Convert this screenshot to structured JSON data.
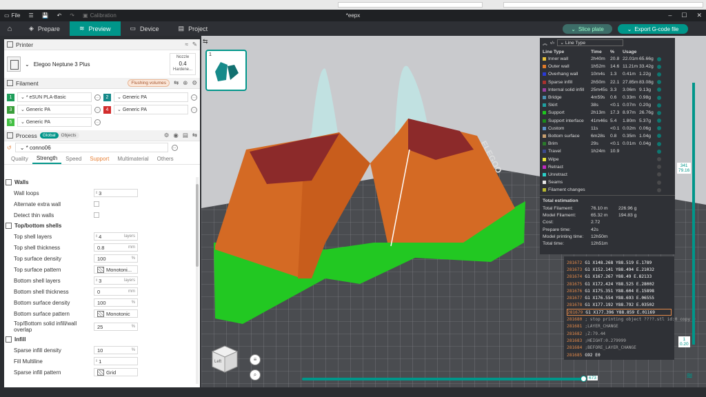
{
  "titlebar": {
    "file_label": "File",
    "calibration_label": "Calibration",
    "doc_title": "*eepx",
    "minimize": "–",
    "maximize": "☐",
    "close": "✕"
  },
  "tabs": [
    {
      "label": "Prepare"
    },
    {
      "label": "Preview"
    },
    {
      "label": "Device"
    },
    {
      "label": "Project"
    }
  ],
  "actions": {
    "slice_label": "Slice plate",
    "export_label": "Export G-code file"
  },
  "printer": {
    "section_label": "Printer",
    "name": "Elegoo Neptune 3 Plus",
    "nozzle_label": "Nozzle",
    "nozzle_value": "0.4",
    "nozzle_sub": "Hardene..."
  },
  "filament": {
    "section_label": "Filament",
    "flush_label": "Flushing volumes",
    "items": [
      {
        "num": "1",
        "name": "* eSUN PLA-Basic",
        "color": "#1f9e5a"
      },
      {
        "num": "2",
        "name": "Generic PA",
        "color": "#168a8a"
      },
      {
        "num": "3",
        "name": "Generic PA",
        "color": "#3a9e3a"
      },
      {
        "num": "4",
        "name": "Generic PA",
        "color": "#d22c2c"
      },
      {
        "num": "5",
        "name": "Generic PA",
        "color": "#44c044"
      }
    ]
  },
  "process": {
    "section_label": "Process",
    "global_label": "Global",
    "objects_label": "Objects",
    "preset_name": "* conno06",
    "tabs": [
      "Quality",
      "Strength",
      "Speed",
      "Support",
      "Multimaterial",
      "Others"
    ]
  },
  "settings": {
    "walls_label": "Walls",
    "wall_loops_label": "Wall loops",
    "wall_loops_value": "3",
    "alt_extra_wall_label": "Alternate extra wall",
    "detect_thin_walls_label": "Detect thin walls",
    "top_bottom_label": "Top/bottom shells",
    "top_layers_label": "Top shell layers",
    "top_layers_value": "4",
    "top_layers_unit": "layers",
    "top_thickness_label": "Top shell thickness",
    "top_thickness_value": "0.8",
    "top_thickness_unit": "mm",
    "top_density_label": "Top surface density",
    "top_density_value": "100",
    "top_density_unit": "%",
    "top_pattern_label": "Top surface pattern",
    "top_pattern_value": "Monotoni...",
    "bottom_layers_label": "Bottom shell layers",
    "bottom_layers_value": "3",
    "bottom_layers_unit": "layers",
    "bottom_thickness_label": "Bottom shell thickness",
    "bottom_thickness_value": "0",
    "bottom_thickness_unit": "mm",
    "bottom_density_label": "Bottom surface density",
    "bottom_density_value": "100",
    "bottom_density_unit": "%",
    "bottom_pattern_label": "Bottom surface pattern",
    "bottom_pattern_value": "Monotonic",
    "solid_overlap_label_1": "Top/Bottom solid infill/wall",
    "solid_overlap_label_2": "overlap",
    "solid_overlap_value": "25",
    "solid_overlap_unit": "%",
    "infill_label": "Infill",
    "sparse_density_label": "Sparse infill density",
    "sparse_density_value": "10",
    "sparse_density_unit": "%",
    "fill_multiline_label": "Fill Multiline",
    "fill_multiline_value": "1",
    "sparse_pattern_label": "Sparse infill pattern",
    "sparse_pattern_value": "Grid"
  },
  "plate": {
    "number": "1"
  },
  "legend": {
    "view_type": "Line Type",
    "headers": [
      "Line Type",
      "Time",
      "%",
      "Usage"
    ],
    "rows": [
      {
        "name": "Inner wall",
        "time": "2h40m",
        "pct": "20.8",
        "len": "22.01m",
        "weight": "65.66g",
        "color": "#e8c13a"
      },
      {
        "name": "Outer wall",
        "time": "1h52m",
        "pct": "14.6",
        "len": "11.21m",
        "weight": "33.42g",
        "color": "#e07b2a"
      },
      {
        "name": "Overhang wall",
        "time": "10m4s",
        "pct": "1.3",
        "len": "0.41m",
        "weight": "1.22g",
        "color": "#2a3ad6"
      },
      {
        "name": "Sparse infill",
        "time": "2h50m",
        "pct": "22.1",
        "len": "27.85m",
        "weight": "83.08g",
        "color": "#a8322e"
      },
      {
        "name": "Internal solid infill",
        "time": "25m45s",
        "pct": "3.3",
        "len": "3.06m",
        "weight": "9.13g",
        "color": "#9a3fa0"
      },
      {
        "name": "Bridge",
        "time": "4m59s",
        "pct": "0.6",
        "len": "0.33m",
        "weight": "0.98g",
        "color": "#4a8fb0"
      },
      {
        "name": "Skirt",
        "time": "38s",
        "pct": "<0.1",
        "len": "0.07m",
        "weight": "0.20g",
        "color": "#1fa0a0"
      },
      {
        "name": "Support",
        "time": "2h13m",
        "pct": "17.3",
        "len": "8.97m",
        "weight": "26.76g",
        "color": "#1ec81e"
      },
      {
        "name": "Support interface",
        "time": "41m46s",
        "pct": "5.4",
        "len": "1.80m",
        "weight": "5.37g",
        "color": "#1a8a1a"
      },
      {
        "name": "Custom",
        "time": "11s",
        "pct": "<0.1",
        "len": "0.02m",
        "weight": "0.06g",
        "color": "#5e92c8"
      },
      {
        "name": "Bottom surface",
        "time": "6m28s",
        "pct": "0.8",
        "len": "0.35m",
        "weight": "1.04g",
        "color": "#c8a070"
      },
      {
        "name": "Brim",
        "time": "29s",
        "pct": "<0.1",
        "len": "0.01m",
        "weight": "0.04g",
        "color": "#2a7a2a"
      },
      {
        "name": "Travel",
        "time": "1h24m",
        "pct": "10.9",
        "len": "",
        "weight": "",
        "color": "#3c4a8c"
      },
      {
        "name": "Wipe",
        "time": "",
        "pct": "",
        "len": "",
        "weight": "",
        "color": "#e8e43a"
      },
      {
        "name": "Retract",
        "time": "",
        "pct": "",
        "len": "",
        "weight": "",
        "color": "#c02ac0"
      },
      {
        "name": "Unretract",
        "time": "",
        "pct": "",
        "len": "",
        "weight": "",
        "color": "#2ad0c8"
      },
      {
        "name": "Seams",
        "time": "",
        "pct": "",
        "len": "",
        "weight": "",
        "color": "#e8e8e8"
      },
      {
        "name": "Filament changes",
        "time": "",
        "pct": "",
        "len": "",
        "weight": "",
        "color": "#b8b830"
      }
    ],
    "total_label": "Total estimation",
    "totals": [
      {
        "label": "Total Filament:",
        "a": "76.10 m",
        "b": "226.96 g"
      },
      {
        "label": "Model Filament:",
        "a": "65.32 m",
        "b": "194.83 g"
      },
      {
        "label": "Cost:",
        "a": "2.72",
        "b": ""
      },
      {
        "label": "Prepare time:",
        "a": "42s",
        "b": ""
      },
      {
        "label": "Model printing time:",
        "a": "12h50m",
        "b": ""
      },
      {
        "label": "Total time:",
        "a": "12h51m",
        "b": ""
      }
    ]
  },
  "gcode": [
    {
      "ln": "281672",
      "cmd": "G1 X148.268 Y88.519 E.1789"
    },
    {
      "ln": "281673",
      "cmd": "G1 X152.141 Y88.494 E.21032"
    },
    {
      "ln": "281674",
      "cmd": "G1 X167.267 Y88.49 E.82133"
    },
    {
      "ln": "281675",
      "cmd": "G1 X172.424 Y88.525 E.28002"
    },
    {
      "ln": "281676",
      "cmd": "G1 X175.351 Y88.604 E.15898"
    },
    {
      "ln": "281677",
      "cmd": "G1 X176.554 Y88.693 E.06555"
    },
    {
      "ln": "281678",
      "cmd": "G1 X177.192 Y88.792 E.03502"
    },
    {
      "ln": "281679",
      "cmd": "G1 X177.396 Y88.859 E.01169"
    },
    {
      "ln": "281680",
      "cmd": "; stop printing object ????.stl id:0 copy 0"
    },
    {
      "ln": "281681",
      "cmd": ";LAYER_CHANGE"
    },
    {
      "ln": "281682",
      "cmd": ";Z:79.44"
    },
    {
      "ln": "281683",
      "cmd": ";HEIGHT:0.279999"
    },
    {
      "ln": "281684",
      "cmd": ";BEFORE_LAYER_CHANGE"
    },
    {
      "ln": "281685",
      "cmd": "G92 E0"
    }
  ],
  "sliders": {
    "layer_top": "341",
    "height_top": "79.16",
    "layer_bottom": "1",
    "height_bottom": "0.20",
    "move_value": "673"
  },
  "viewcube": {
    "face_label": "Left"
  }
}
